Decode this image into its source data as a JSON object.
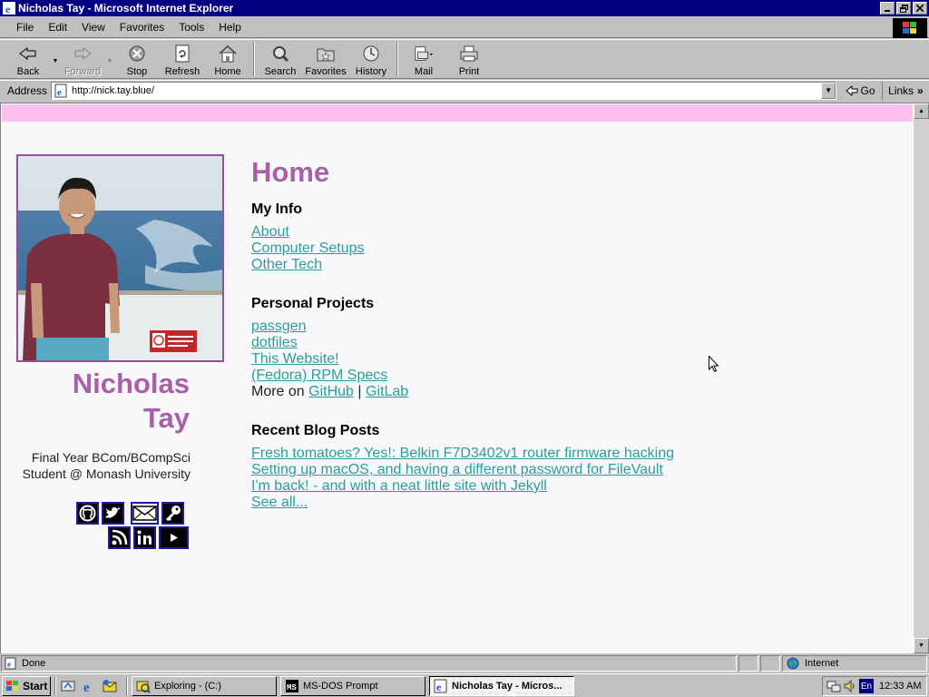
{
  "window": {
    "title": "Nicholas Tay - Microsoft Internet Explorer"
  },
  "menu": [
    "File",
    "Edit",
    "View",
    "Favorites",
    "Tools",
    "Help"
  ],
  "toolbar": {
    "back": "Back",
    "forward": "Forward",
    "stop": "Stop",
    "refresh": "Refresh",
    "home": "Home",
    "search": "Search",
    "favorites": "Favorites",
    "history": "History",
    "mail": "Mail",
    "print": "Print"
  },
  "address": {
    "label": "Address",
    "url": "http://nick.tay.blue/",
    "go": "Go",
    "links": "Links"
  },
  "sidebar": {
    "name_first": "Nicholas",
    "name_last": "Tay",
    "description": "Final Year BCom/BCompSci Student @ Monash University",
    "social_icons": [
      "github-icon",
      "twitter-icon",
      "email-icon",
      "key-icon",
      "rss-icon",
      "linkedin-icon",
      "youtube-icon"
    ]
  },
  "main": {
    "title": "Home",
    "my_info": {
      "heading": "My Info",
      "links": [
        "About",
        "Computer Setups",
        "Other Tech"
      ]
    },
    "projects": {
      "heading": "Personal Projects",
      "links": [
        "passgen",
        "dotfiles",
        "This Website!",
        "(Fedora) RPM Specs"
      ],
      "more_prefix": "More on",
      "more_github": "GitHub",
      "more_sep": "|",
      "more_gitlab": "GitLab"
    },
    "blog": {
      "heading": "Recent Blog Posts",
      "links": [
        "Fresh tomatoes? Yes!: Belkin F7D3402v1 router firmware hacking",
        "Setting up macOS, and having a different password for FileVault",
        "I'm back! - and with a neat little site with Jekyll",
        "See all..."
      ]
    }
  },
  "status": {
    "text": "Done",
    "zone": "Internet"
  },
  "taskbar": {
    "start": "Start",
    "tasks": [
      "Exploring - (C:)",
      "MS-DOS Prompt",
      "Nicholas Tay - Micros..."
    ],
    "lang": "En",
    "clock": "12:33 AM"
  },
  "colors": {
    "accent": "#a861a8",
    "link": "#2c9c9c",
    "pink_bar": "#ffc0ee",
    "titlebar": "#000080"
  }
}
